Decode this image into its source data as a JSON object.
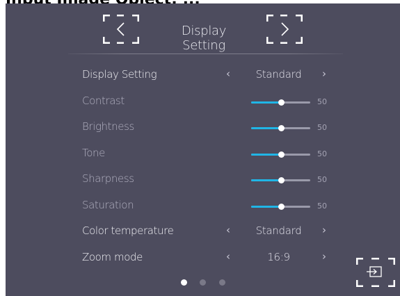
{
  "overlay": {
    "caption": "Input Image Object: ..."
  },
  "header": {
    "title": "Display Setting"
  },
  "settings": [
    {
      "label": "Display Setting",
      "value": "Standard"
    },
    {
      "label": "Contrast",
      "level": 50,
      "level_text": "50"
    },
    {
      "label": "Brightness",
      "level": 50,
      "level_text": "50"
    },
    {
      "label": "Tone",
      "level": 50,
      "level_text": "50"
    },
    {
      "label": "Sharpness",
      "level": 50,
      "level_text": "50"
    },
    {
      "label": "Saturation",
      "level": 50,
      "level_text": "50"
    },
    {
      "label": "Color temperature",
      "value": "Standard"
    },
    {
      "label": "Zoom mode",
      "value": "16:9"
    }
  ],
  "arrows": {
    "left": "‹",
    "right": "›"
  },
  "pagination": {
    "total": 3,
    "active": 1
  },
  "colors": {
    "background": "#4d4c5e",
    "accent": "#20b5e6",
    "track": "#9a9aaa"
  },
  "icons": [
    "chevron-left-icon",
    "chevron-right-icon",
    "input-source-icon"
  ]
}
